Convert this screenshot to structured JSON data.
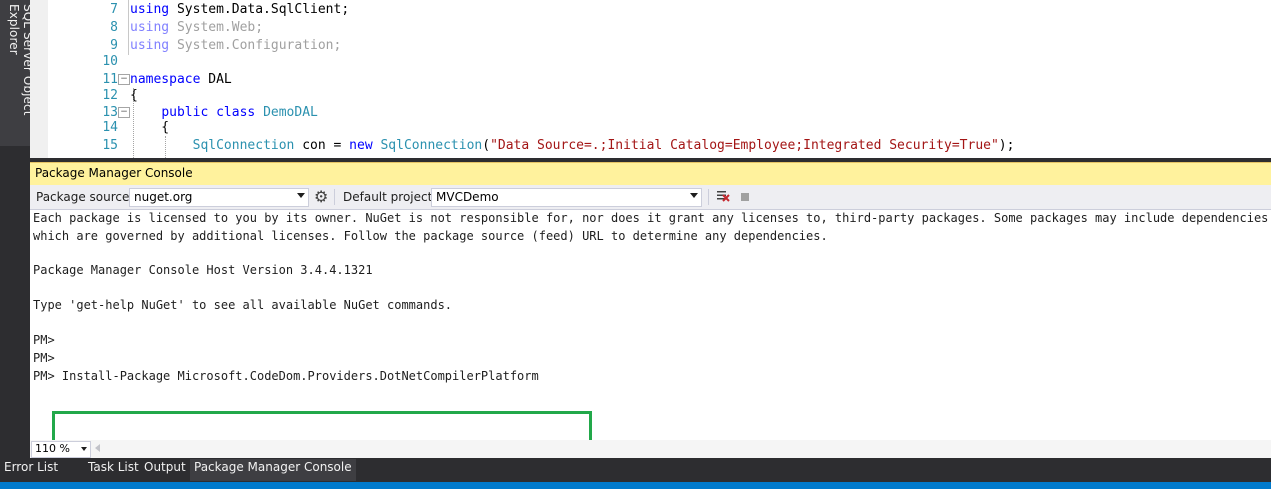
{
  "side_tab": {
    "label": "SQL Server Object Explorer"
  },
  "editor": {
    "lines": [
      {
        "num": "7",
        "parts": [
          [
            "kw",
            "using"
          ],
          [
            "plain",
            " System.Data.SqlClient;"
          ]
        ]
      },
      {
        "num": "8",
        "parts": [
          [
            "dimkw",
            "using"
          ],
          [
            "dim",
            " System.Web;"
          ]
        ]
      },
      {
        "num": "9",
        "parts": [
          [
            "dimkw",
            "using"
          ],
          [
            "dim",
            " System.Configuration;"
          ]
        ]
      },
      {
        "num": "10",
        "parts": []
      },
      {
        "num": "11",
        "fold": "−",
        "parts": [
          [
            "kw",
            "namespace"
          ],
          [
            "plain",
            " DAL"
          ]
        ]
      },
      {
        "num": "12",
        "parts": [
          [
            "plain",
            "{"
          ]
        ]
      },
      {
        "num": "13",
        "fold": "−",
        "parts": [
          [
            "plain",
            "    "
          ],
          [
            "kw",
            "public"
          ],
          [
            "plain",
            " "
          ],
          [
            "kw",
            "class"
          ],
          [
            "plain",
            " "
          ],
          [
            "ty",
            "DemoDAL"
          ]
        ]
      },
      {
        "num": "14",
        "parts": [
          [
            "plain",
            "    {"
          ]
        ]
      },
      {
        "num": "15",
        "parts": [
          [
            "plain",
            "        "
          ],
          [
            "ty",
            "SqlConnection"
          ],
          [
            "plain",
            " con = "
          ],
          [
            "kw",
            "new"
          ],
          [
            "plain",
            " "
          ],
          [
            "ty",
            "SqlConnection"
          ],
          [
            "plain",
            "("
          ],
          [
            "str",
            "\"Data Source=.;Initial Catalog=Employee;Integrated Security=True\""
          ],
          [
            "plain",
            ");"
          ]
        ]
      }
    ]
  },
  "pmc": {
    "title": "Package Manager Console",
    "package_source_label": "Package source:",
    "package_source_value": "nuget.org",
    "default_project_label": "Default project:",
    "default_project_value": "MVCDemo",
    "console_lines": [
      "Each package is licensed to you by its owner. NuGet is not responsible for, nor does it grant any licenses to, third-party packages. Some packages may include dependencies",
      "which are governed by additional licenses. Follow the package source (feed) URL to determine any dependencies.",
      "",
      "Package Manager Console Host Version 3.4.4.1321",
      "",
      "Type 'get-help NuGet' to see all available NuGet commands.",
      "",
      "PM>",
      "PM>",
      "PM> Install-Package Microsoft.CodeDom.Providers.DotNetCompilerPlatform"
    ],
    "zoom": "110 %"
  },
  "bottom_tabs": [
    "Error List",
    "Task List",
    "Output",
    "Package Manager Console"
  ],
  "colors": {
    "highlight_box": "#22a84a",
    "pmc_title_bg": "#fff29d",
    "statusbar": "#007acc"
  }
}
